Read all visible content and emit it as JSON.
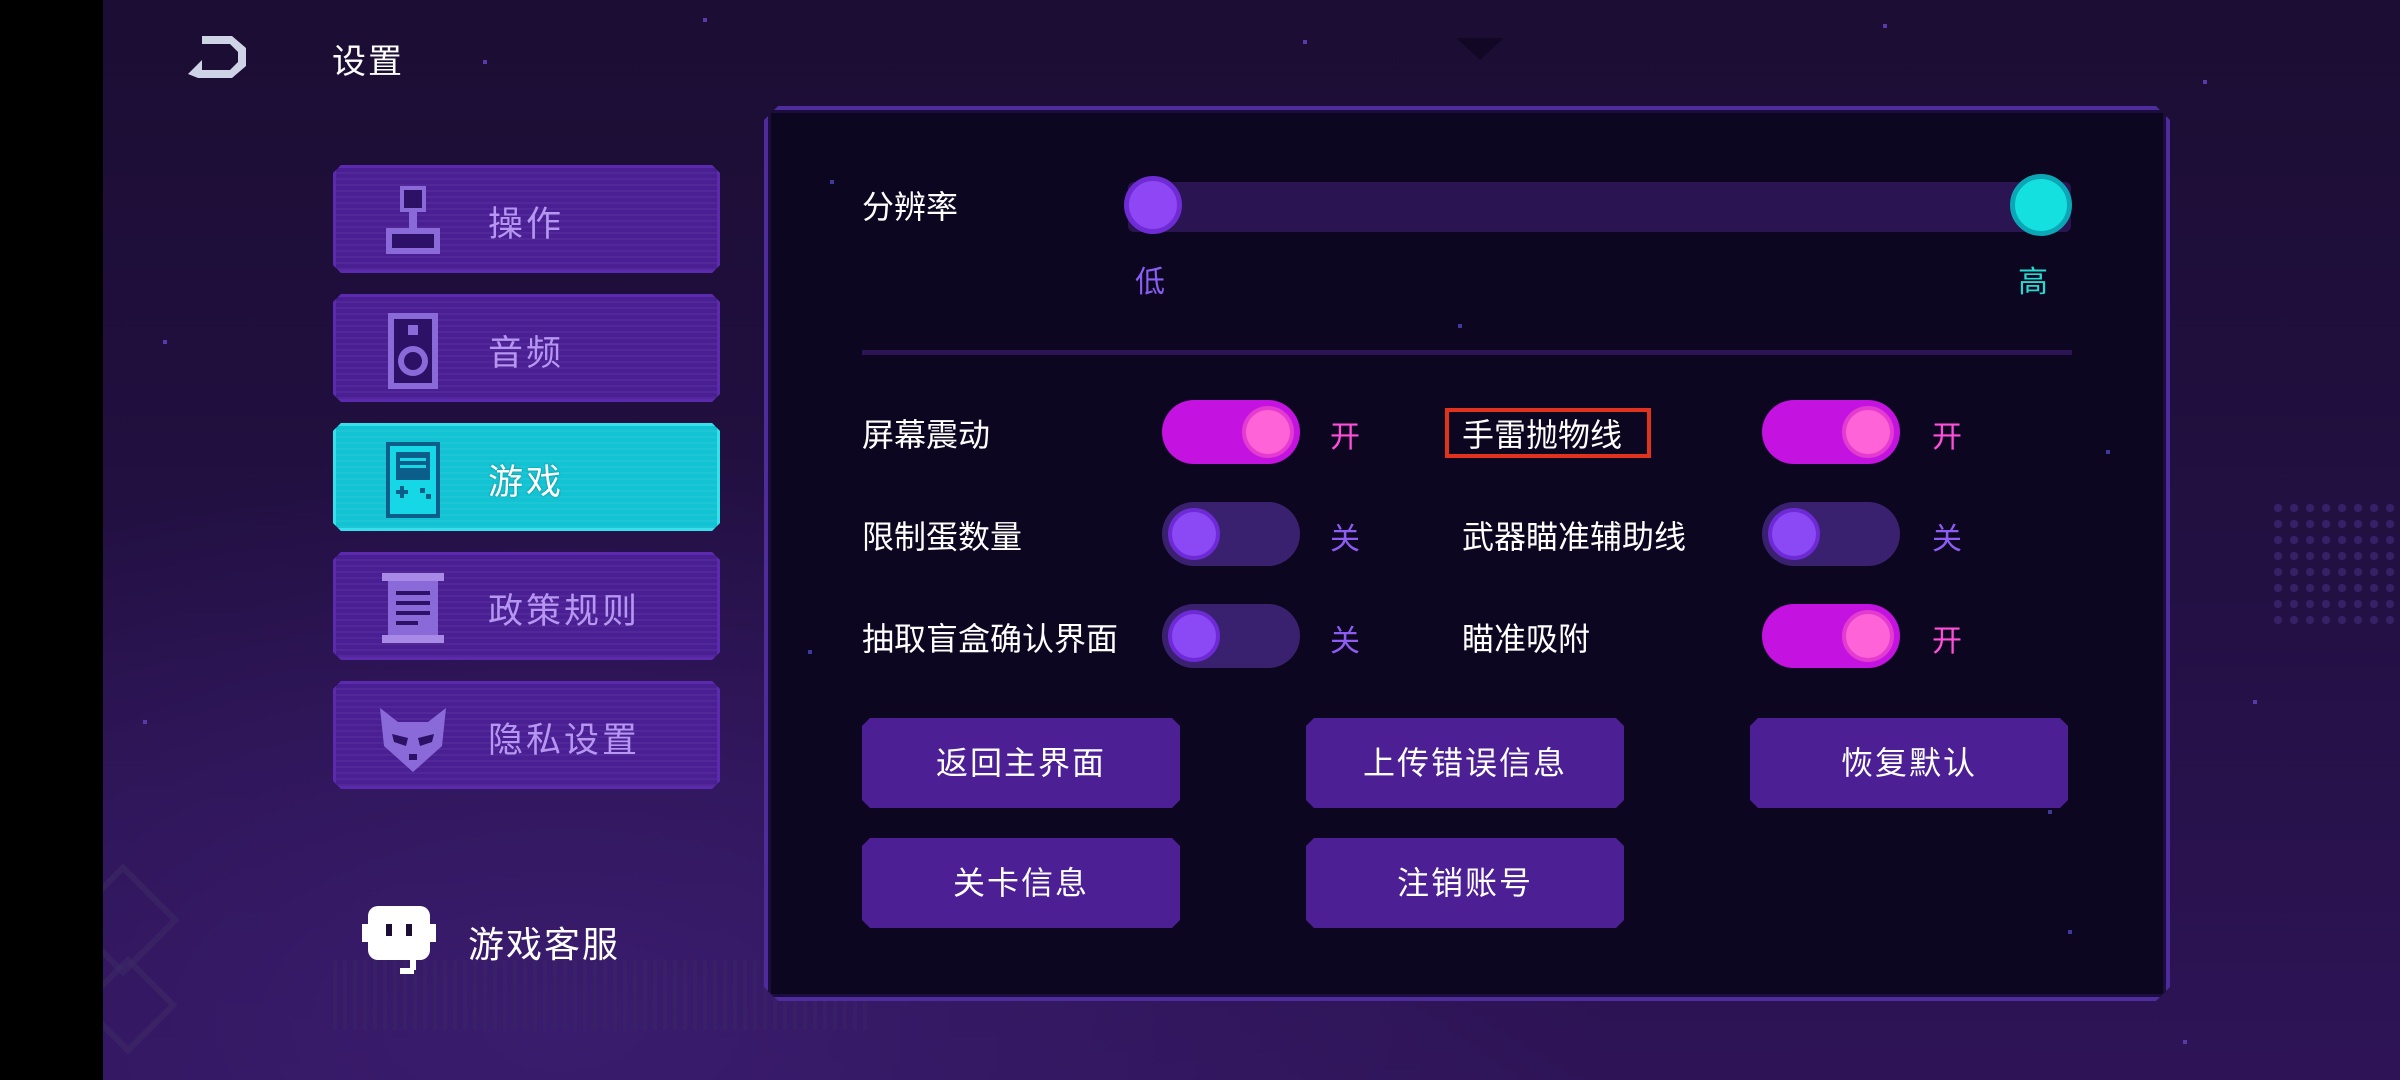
{
  "header": {
    "title": "设置",
    "back_icon": "back-arrow-icon"
  },
  "sidebar": {
    "items": [
      {
        "label": "操作",
        "icon": "joystick-icon",
        "active": false
      },
      {
        "label": "音频",
        "icon": "speaker-icon",
        "active": false
      },
      {
        "label": "游戏",
        "icon": "gameboy-icon",
        "active": true
      },
      {
        "label": "政策规则",
        "icon": "scroll-icon",
        "active": false
      },
      {
        "label": "隐私设置",
        "icon": "fox-mask-icon",
        "active": false
      }
    ],
    "support": {
      "label": "游戏客服",
      "icon": "support-bot-icon"
    }
  },
  "resolution": {
    "label": "分辨率",
    "low_label": "低",
    "high_label": "高",
    "value": 1.0
  },
  "options": [
    {
      "label": "屏幕震动",
      "on": true,
      "state_text": "开"
    },
    {
      "label": "手雷抛物线",
      "on": true,
      "state_text": "开",
      "highlighted": true
    },
    {
      "label": "限制蛋数量",
      "on": false,
      "state_text": "关"
    },
    {
      "label": "武器瞄准辅助线",
      "on": false,
      "state_text": "关"
    },
    {
      "label": "抽取盲盒确认界面",
      "on": false,
      "state_text": "关"
    },
    {
      "label": "瞄准吸附",
      "on": true,
      "state_text": "开"
    }
  ],
  "buttons": {
    "return_main": "返回主界面",
    "upload_error": "上传错误信息",
    "restore_default": "恢复默认",
    "level_info": "关卡信息",
    "cancel_account": "注销账号"
  },
  "colors": {
    "accent_cyan": "#12c3d3",
    "accent_purple": "#4b1f94",
    "toggle_on": "#c412e0",
    "toggle_off": "#3a2170",
    "highlight_box": "#e0321f"
  }
}
